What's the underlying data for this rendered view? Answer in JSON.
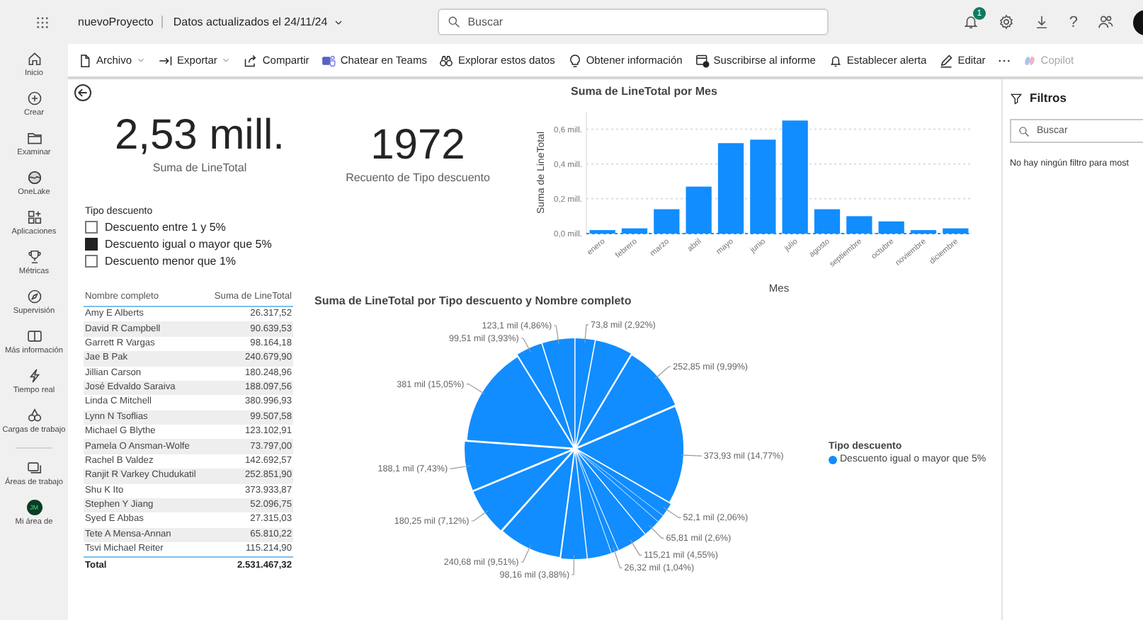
{
  "header": {
    "project": "nuevoProyecto",
    "dataset_status": "Datos actualizados el 24/11/24",
    "search": {
      "placeholder": "Buscar"
    },
    "notification_count": "1",
    "help": "?"
  },
  "toolbar": [
    {
      "label": "Archivo",
      "has_menu": true,
      "disabled": false
    },
    {
      "label": "Exportar",
      "has_menu": true,
      "disabled": false
    },
    {
      "label": "Compartir",
      "has_menu": false,
      "disabled": false
    },
    {
      "label": "Chatear en Teams",
      "has_menu": false,
      "disabled": false
    },
    {
      "label": "Explorar estos datos",
      "has_menu": false,
      "disabled": false
    },
    {
      "label": "Obtener información",
      "has_menu": false,
      "disabled": false
    },
    {
      "label": "Suscribirse al informe",
      "has_menu": false,
      "disabled": false
    },
    {
      "label": "Establecer alerta",
      "has_menu": false,
      "disabled": false
    },
    {
      "label": "Editar",
      "has_menu": false,
      "disabled": false
    },
    {
      "label": "Copilot",
      "has_menu": false,
      "disabled": true
    }
  ],
  "nav": [
    {
      "label": "Inicio",
      "kind": "icon"
    },
    {
      "label": "Crear",
      "kind": "icon"
    },
    {
      "label": "Examinar",
      "kind": "icon"
    },
    {
      "label": "OneLake",
      "kind": "icon"
    },
    {
      "label": "Aplicaciones",
      "kind": "icon"
    },
    {
      "label": "Métricas",
      "kind": "icon"
    },
    {
      "label": "Supervisión",
      "kind": "icon"
    },
    {
      "label": "Más información",
      "kind": "icon"
    },
    {
      "label": "Tiempo real",
      "kind": "icon"
    },
    {
      "label": "Cargas de trabajo",
      "kind": "icon"
    },
    {
      "label": "Áreas de trabajo",
      "kind": "icon"
    },
    {
      "label": "Mi área de",
      "kind": "avatar",
      "initials": "JM"
    }
  ],
  "report": {
    "kpis": [
      {
        "value": "2,53 mill.",
        "label": "Suma de LineTotal"
      },
      {
        "value": "1972",
        "label": "Recuento de Tipo descuento"
      }
    ],
    "slicer": {
      "title": "Tipo descuento",
      "items": [
        {
          "label": "Descuento entre 1 y 5%",
          "checked": false
        },
        {
          "label": "Descuento igual o mayor que 5%",
          "checked": true
        },
        {
          "label": "Descuento menor que 1%",
          "checked": false
        }
      ]
    },
    "table": {
      "columns": [
        "Nombre completo",
        "Suma de LineTotal"
      ],
      "rows": [
        [
          "Amy E Alberts",
          "26.317,52"
        ],
        [
          "David R Campbell",
          "90.639,53"
        ],
        [
          "Garrett R Vargas",
          "98.164,18"
        ],
        [
          "Jae B Pak",
          "240.679,90"
        ],
        [
          "Jillian Carson",
          "180.248,96"
        ],
        [
          "José Edvaldo Saraiva",
          "188.097,56"
        ],
        [
          "Linda C Mitchell",
          "380.996,93"
        ],
        [
          "Lynn N Tsoflias",
          "99.507,58"
        ],
        [
          "Michael G Blythe",
          "123.102,91"
        ],
        [
          "Pamela O Ansman-Wolfe",
          "73.797,00"
        ],
        [
          "Rachel B Valdez",
          "142.692,57"
        ],
        [
          "Ranjit R Varkey Chudukatil",
          "252.851,90"
        ],
        [
          "Shu K Ito",
          "373.933,87"
        ],
        [
          "Stephen Y Jiang",
          "52.096,75"
        ],
        [
          "Syed E Abbas",
          "27.315,03"
        ],
        [
          "Tete A Mensa-Annan",
          "65.810,22"
        ],
        [
          "Tsvi Michael Reiter",
          "115.214,90"
        ]
      ],
      "total": [
        "Total",
        "2.531.467,32"
      ]
    },
    "bar_chart": {
      "chart_data": {
        "type": "bar",
        "title": "Suma de LineTotal por Mes",
        "xlabel": "Mes",
        "ylabel": "Suma de LineTotal",
        "categories": [
          "enero",
          "febrero",
          "marzo",
          "abril",
          "mayo",
          "junio",
          "julio",
          "agosto",
          "septiembre",
          "octubre",
          "noviembre",
          "diciembre"
        ],
        "values": [
          0.02,
          0.03,
          0.14,
          0.27,
          0.52,
          0.54,
          0.65,
          0.14,
          0.1,
          0.07,
          0.02,
          0.03
        ],
        "grid": true,
        "ylim": [
          0,
          0.7
        ],
        "yticks": [
          {
            "value": 0,
            "label": "0,0 mill."
          },
          {
            "value": 0.2,
            "label": "0,2 mill."
          },
          {
            "value": 0.4,
            "label": "0,4 mill."
          },
          {
            "value": 0.6,
            "label": "0,6 mill."
          }
        ]
      }
    },
    "pie_chart": {
      "chart_data": {
        "type": "pie",
        "title": "Suma de LineTotal por Tipo descuento y Nombre completo",
        "values": [
          73.8,
          142.69,
          252.85,
          373.93,
          52.1,
          27.32,
          65.81,
          115.21,
          26.32,
          90.64,
          98.16,
          240.68,
          180.25,
          188.1,
          381,
          99.51,
          123.1
        ],
        "value_labels": [
          "73,8 mil (2,92%)",
          null,
          "252,85 mil (9,99%)",
          "373,93 mil (14,77%)",
          "52,1 mil (2,06%)",
          null,
          "65,81 mil (2,6%)",
          "115,21 mil (4,55%)",
          "26,32 mil (1,04%)",
          null,
          "98,16 mil (3,88%)",
          "240,68 mil (9,51%)",
          "180,25 mil (7,12%)",
          "188,1 mil (7,43%)",
          "381 mil (15,05%)",
          "99,51 mil (3,93%)",
          "123,1 mil (4,86%)"
        ]
      },
      "legend": {
        "title": "Tipo descuento",
        "items": [
          {
            "label": "Descuento igual o mayor que 5%",
            "color": "#118dff"
          }
        ]
      }
    }
  },
  "filters": {
    "title": "Filtros",
    "search": {
      "placeholder": "Buscar"
    },
    "empty_message": "No hay ningún filtro para most"
  }
}
